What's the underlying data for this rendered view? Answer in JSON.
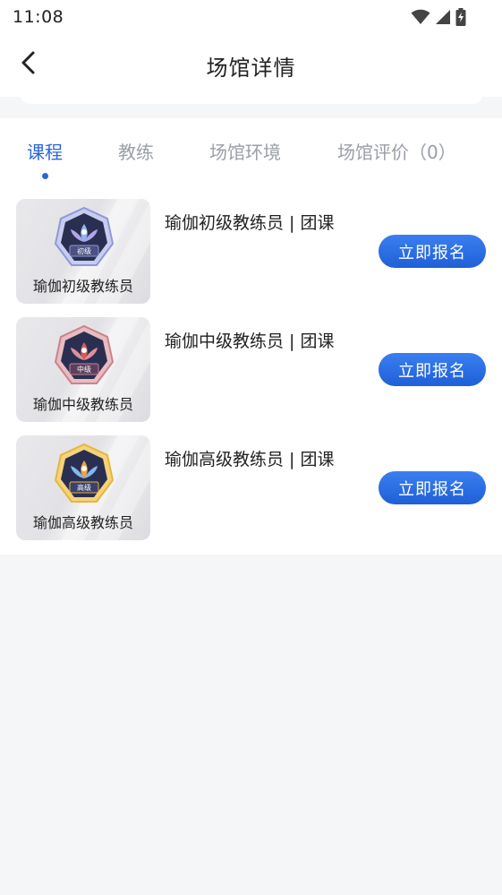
{
  "status_bar": {
    "time": "11:08",
    "icons": [
      "wifi-icon",
      "signal-icon",
      "battery-charging-icon"
    ]
  },
  "header": {
    "title": "场馆详情",
    "back_icon": "chevron-left-icon"
  },
  "tabs": [
    {
      "label": "课程",
      "active": true
    },
    {
      "label": "教练",
      "active": false
    },
    {
      "label": "场馆环境",
      "active": false
    },
    {
      "label": "场馆评价（0）",
      "active": false
    }
  ],
  "courses": [
    {
      "thumb_caption": "瑜伽初级教练员",
      "badge_text": "初级",
      "title": "瑜伽初级教练员 | 团课",
      "button": "立即报名"
    },
    {
      "thumb_caption": "瑜伽中级教练员",
      "badge_text": "中级",
      "title": "瑜伽中级教练员 | 团课",
      "button": "立即报名"
    },
    {
      "thumb_caption": "瑜伽高级教练员",
      "badge_text": "高级",
      "title": "瑜伽高级教练员 | 团课",
      "button": "立即报名"
    }
  ],
  "colors": {
    "accent": "#2a66d9",
    "button": "#2a6ee6",
    "badge_primary": "#8f98d8",
    "badge_intermediate": "#c9838a",
    "badge_advanced": "#e8b53d",
    "badge_dark": "#2a2f52"
  }
}
